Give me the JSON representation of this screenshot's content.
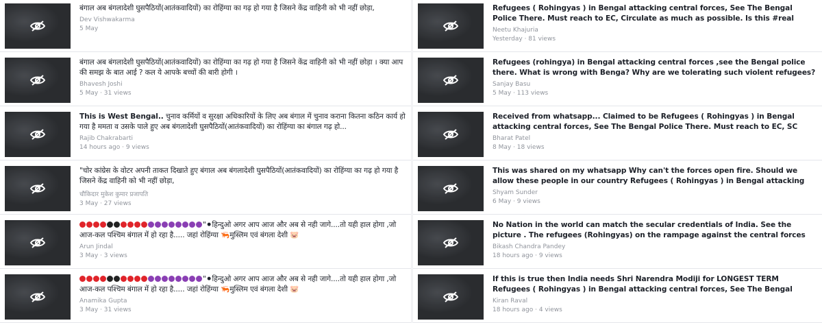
{
  "left": [
    {
      "title": "बंगाल अब बंगलादेशी घुसपैठियों(आतंकवादियों) का रोहिंग्या का गढ़ हो गया है जिसने केंद्र वाहिनी को भी नहीं छोड़ा,",
      "author": "Dev Vishwakarma",
      "date": "5 May",
      "views": ""
    },
    {
      "title": "बंगाल अब बंगलादेशी घुसपैठियों(आतंकवादियों) का रोहिंग्या का गढ़ हो गया है जिसने केंद्र वाहिनी को भी नहीं छोड़ा । क्या आप की समझ के बात आई ? कल ये आपके बच्चों की बारी होगी ।",
      "author": "Bhavesh Joshi",
      "date": "5 May",
      "views": "31 views"
    },
    {
      "title_lead": "This is West Bengal..",
      "title": " चुनाव कर्मियों व सुरक्षा अधिकारियों के लिए अब बंगाल में चुनाव कराना कितना कठिन कार्य हो गया है ममता व उसके पाले हुए अब बंगलादेशी घुसपैठियों(आतंकवादियों) का रोहिंग्या का बंगाल गढ़ हो...",
      "author": "Rajib Chakrabarti",
      "date": "14 hours ago",
      "views": "9 views"
    },
    {
      "title": "\"चोर कांग्रेस के वोटर अपनी ताकत दिखाते हुए बंगाल अब बंगलादेशी घुसपैठियों(आतंकवादियों) का रोहिंग्या का गढ़ हो गया है जिसने केंद्र वाहिनी को भी नहीं छोड़ा,",
      "author": "चौकिदार मुकेश कुमार प्रजापति",
      "date": "3 May",
      "views": "27 views"
    },
    {
      "title": "\"⚫हिन्दुओ अगर आप आज और अब से नही जागे....तो यही हाल होगा ,जो आज-कल पश्चिम बंगाल में हो रहा है..... जहां रोहिंग्या 🦐मुस्लिम एवं बंगला देशी 🐷",
      "author": "Arun Jindal",
      "date": "3 May",
      "views": "3 views"
    },
    {
      "title": "\"⚫हिन्दुओ अगर आप आज और अब से नही जागे....तो यही हाल होगा ,जो आज-कल पश्चिम बंगाल में हो रहा है..... जहां रोहिंग्या 🦐मुस्लिम एवं बंगला देशी 🐷",
      "author": "Anamika Gupta",
      "date": "3 May",
      "views": "31 views"
    }
  ],
  "right": [
    {
      "title": "Refugees ( Rohingyas ) in Bengal attacking central forces, See The Bengal Police There. Must reach to EC, Circulate as much as possible. Is this #real video ??? Or #fake video ?",
      "author": "Neetu Khajuria",
      "date": "Yesterday",
      "views": "81 views"
    },
    {
      "title": "Refugees (rohingya) in Bengal attacking central forces ,see the Bengal police there. What is wrong with Benga? Why are we tolerating such violent refugees? Disgusting!",
      "author": "Sanjay Basu",
      "date": "5 May",
      "views": "113 views"
    },
    {
      "title": "Received from whatsapp... Claimed to be Refugees ( Rohingyas ) in Bengal attacking central forces, See The Bengal Police There. Must reach to EC, SC",
      "author": "Bharat Patel",
      "date": "8 May",
      "views": "18 views"
    },
    {
      "title": "This was shared on my whatsapp Why can't the forces open fire. Should we allow these people in our country Refugees ( Rohingyas ) in Bengal attacking central forces, The Bengal Police as...",
      "author": "Shyam Sunder",
      "date": "6 May",
      "views": "9 views"
    },
    {
      "title": "No Nation in the world can match the secular credentials of India. See the picture . The refugees (Rohingyas) on the rampage against the central forces and the mute Bengal police force. Mera...",
      "author": "Bikash Chandra Pandey",
      "date": "18 hours ago",
      "views": "9 views"
    },
    {
      "title": "If this is true then India needs Shri Narendra Modiji for LONGEST TERM Refugees ( Rohingyas ) in Bengal attacking central forces, See The Bengal Police There. Must reach to EC, Circulat...",
      "author": "Kiran Raval",
      "date": "18 hours ago",
      "views": "4 views"
    }
  ],
  "meta_separator": " · ",
  "icons": {
    "thumb": "eye-slash-icon",
    "emoji": "angry-face-icon"
  }
}
